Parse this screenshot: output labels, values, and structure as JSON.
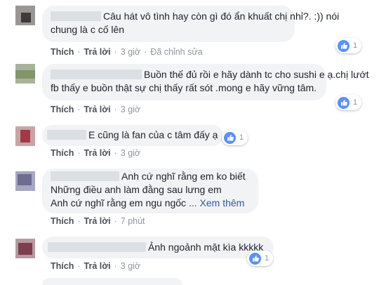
{
  "comments": [
    {
      "text_line1": "Câu hát vô tình hay còn gì đó ẩn khuất chị nhỉ?. :)) nói",
      "text_line2": "chung là c cố lên",
      "like": "Thích",
      "reply": "Trả lời",
      "time": "3 giờ",
      "edited": "Đã chỉnh sửa",
      "reactions": "1"
    },
    {
      "text_line1": "Buồn thế đủ rồi e hãy dành tc cho sushi e ạ.chị lướt",
      "text_line2": "fb thấy e buồn thật sự chị thấy rất sót .mong e hãy vững tâm.",
      "like": "Thích",
      "reply": "Trả lời",
      "time": "3 giờ",
      "reactions": "1"
    },
    {
      "text_line1": "E cũng là fan của c tâm đấy ạ",
      "like": "Thích",
      "reply": "Trả lời",
      "time": "3 giờ",
      "reactions": "1"
    },
    {
      "text_line1": "Anh cứ nghĩ rằng em ko biết",
      "text_line2": "Những điều anh làm đằng sau lưng em",
      "text_line3": "Anh cứ nghĩ rằng em ngu ngốc",
      "see_more": "... Xem thêm",
      "like": "Thích",
      "reply": "Trả lời",
      "time": "7 phút"
    },
    {
      "text_line1": "Ảnh ngoảnh mặt kìa kkkkk",
      "like": "Thích",
      "reply": "Trả lời",
      "time": "3 giờ",
      "reactions": "1"
    }
  ],
  "colors": {
    "bubble": "#f2f3f5",
    "like_badge": "#5890ff",
    "action_link": "#4b4f56",
    "meta": "#90949c"
  },
  "icons": [
    "like-thumb-icon"
  ]
}
